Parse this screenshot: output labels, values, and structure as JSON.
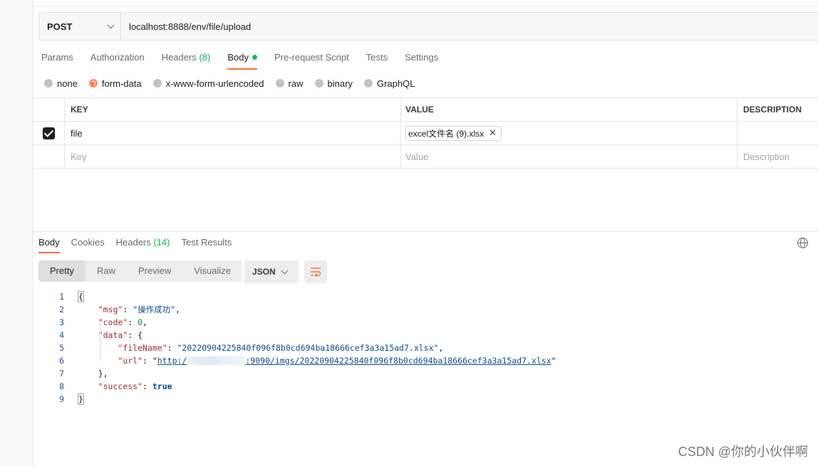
{
  "request": {
    "method": "POST",
    "url": "localhost:8888/env/file/upload"
  },
  "request_tabs": [
    {
      "label": "Params"
    },
    {
      "label": "Authorization"
    },
    {
      "label": "Headers",
      "count": "(8)"
    },
    {
      "label": "Body",
      "active": true
    },
    {
      "label": "Pre-request Script"
    },
    {
      "label": "Tests"
    },
    {
      "label": "Settings"
    }
  ],
  "body_types": [
    {
      "label": "none"
    },
    {
      "label": "form-data",
      "selected": true
    },
    {
      "label": "x-www-form-urlencoded"
    },
    {
      "label": "raw"
    },
    {
      "label": "binary"
    },
    {
      "label": "GraphQL"
    }
  ],
  "form_table": {
    "headers": {
      "key": "KEY",
      "value": "VALUE",
      "description": "DESCRIPTION"
    },
    "rows": [
      {
        "checked": true,
        "key": "file",
        "value": "excel文件名 (9).xlsx",
        "description": ""
      }
    ],
    "placeholders": {
      "key": "Key",
      "value": "Value",
      "description": "Description"
    }
  },
  "response_tabs": [
    {
      "label": "Body",
      "active": true
    },
    {
      "label": "Cookies"
    },
    {
      "label": "Headers",
      "count": "(14)"
    },
    {
      "label": "Test Results"
    }
  ],
  "view_modes": [
    {
      "label": "Pretty",
      "active": true
    },
    {
      "label": "Raw"
    },
    {
      "label": "Preview"
    },
    {
      "label": "Visualize"
    }
  ],
  "format": "JSON",
  "response_json": {
    "msg_key": "\"msg\"",
    "msg_val": "\"操作成功\"",
    "code_key": "\"code\"",
    "code_val": "0",
    "data_key": "\"data\"",
    "filename_key": "\"fileName\"",
    "filename_val": "\"20220904225840f096f8b0cd694ba18666cef3a3a15ad7.xlsx\"",
    "url_key": "\"url\"",
    "url_prefix": "http:/",
    "url_suffix": ":9090/imgs/20220904225840f096f8b0cd694ba18666cef3a3a15ad7.xlsx",
    "success_key": "\"success\"",
    "success_val": "true"
  },
  "line_numbers": [
    "1",
    "2",
    "3",
    "4",
    "5",
    "6",
    "7",
    "8",
    "9"
  ],
  "watermark": "CSDN @你的小伙伴啊",
  "colors": {
    "accent": "#ff6c37",
    "green": "#0cbb52"
  }
}
